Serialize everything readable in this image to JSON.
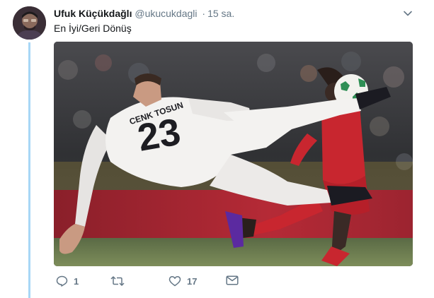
{
  "tweet": {
    "author_name": "Ufuk Küçükdağlı",
    "handle": "@ukucukdagli",
    "separator": "·",
    "timestamp": "15 sa.",
    "text": "En İyi/Geri Dönüş",
    "media": {
      "jersey_name": "CENK TOSUN",
      "jersey_number": "23"
    }
  },
  "actions": {
    "reply_count": "1",
    "retweet_count": "",
    "like_count": "17"
  },
  "icons": {
    "caret": "chevron-down-icon",
    "reply": "reply-icon",
    "retweet": "retweet-icon",
    "like": "heart-icon",
    "message": "envelope-icon"
  },
  "colors": {
    "thread_line": "#a8d7f6",
    "muted": "#657786",
    "text": "#14171a"
  }
}
